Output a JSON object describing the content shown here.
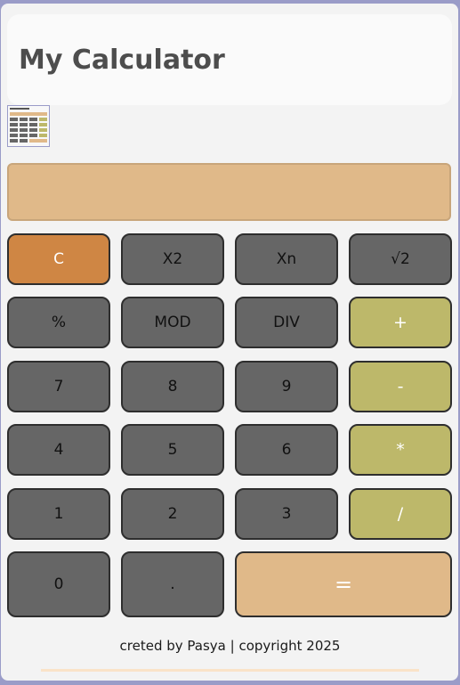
{
  "header": {
    "title": "My Calculator"
  },
  "display": {
    "value": ""
  },
  "buttons": {
    "clear": "C",
    "square": "X2",
    "power": "Xn",
    "sqrt": "√2",
    "percent": "%",
    "mod": "MOD",
    "div": "DIV",
    "plus": "+",
    "seven": "7",
    "eight": "8",
    "nine": "9",
    "minus": "-",
    "four": "4",
    "five": "5",
    "six": "6",
    "multiply": "*",
    "one": "1",
    "two": "2",
    "three": "3",
    "divide": "/",
    "zero": "0",
    "dot": ".",
    "equals": "="
  },
  "footer": {
    "text": "creted by Pasya | copyright 2025"
  },
  "colors": {
    "background": "#9a9cc8",
    "display": "#e0b989",
    "clear": "#cf8644",
    "operator": "#bdb86a",
    "number": "#666666",
    "equals": "#e0b989"
  }
}
